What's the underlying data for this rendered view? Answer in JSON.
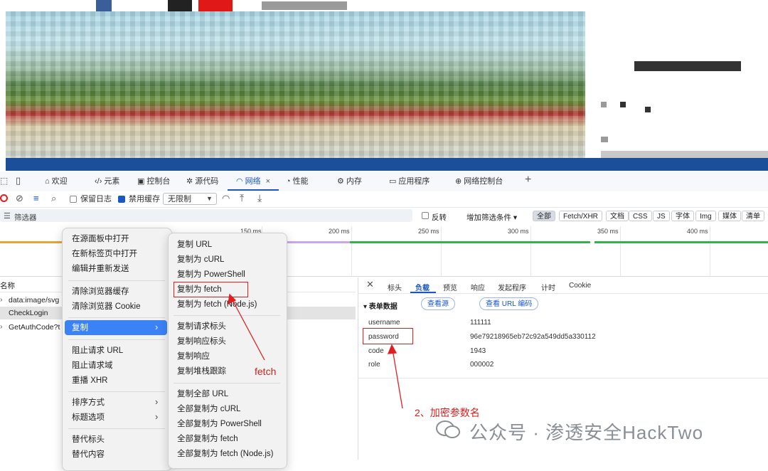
{
  "devtools": {
    "tabs": [
      {
        "label": "欢迎",
        "icon": "home-icon"
      },
      {
        "label": "元素",
        "icon": "code-icon"
      },
      {
        "label": "控制台",
        "icon": "console-icon"
      },
      {
        "label": "源代码",
        "icon": "bug-icon"
      },
      {
        "label": "网络",
        "icon": "wifi-icon",
        "active": true
      },
      {
        "label": "性能",
        "icon": "gauge-icon"
      },
      {
        "label": "内存",
        "icon": "chip-icon"
      },
      {
        "label": "应用程序",
        "icon": "window-icon"
      },
      {
        "label": "网络控制台",
        "icon": "globe-icon"
      }
    ],
    "add_tab_glyph": "+",
    "tab_close_glyph": "×",
    "toolbar": {
      "preserve_log": "保留日志",
      "disable_cache": "禁用缓存",
      "throttle": "无限制"
    },
    "filter": {
      "placeholder": "筛选器",
      "invert": "反转",
      "more_filters": "增加筛选条件 ▾",
      "chips": [
        "全部",
        "Fetch/XHR",
        "文档",
        "CSS",
        "JS",
        "字体",
        "Img",
        "媒体",
        "清单"
      ]
    },
    "timeline_ticks": [
      "150 ms",
      "200 ms",
      "250 ms",
      "300 ms",
      "350 ms",
      "400 ms"
    ],
    "list": {
      "header": "名称",
      "rows": [
        "data:image/svg",
        "CheckLogin",
        "GetAuthCode?t"
      ]
    },
    "detail": {
      "close_glyph": "✕",
      "tabs": [
        "标头",
        "负载",
        "预览",
        "响应",
        "发起程序",
        "计时",
        "Cookie"
      ],
      "active_tab": "负载",
      "section": "▾ 表单数据",
      "view_source": "查看源",
      "view_url": "查看 URL 编码",
      "form": [
        {
          "key": "username",
          "value": "111111"
        },
        {
          "key": "password",
          "value": "96e79218965eb72c92a549dd5a330112"
        },
        {
          "key": "code",
          "value": "1943"
        },
        {
          "key": "role",
          "value": "000002"
        }
      ]
    }
  },
  "context_menu": {
    "items": [
      "在源面板中打开",
      "在新标签页中打开",
      "编辑并重新发送",
      "清除浏览器缓存",
      "清除浏览器 Cookie",
      "复制",
      "阻止请求 URL",
      "阻止请求域",
      "重播 XHR",
      "排序方式",
      "标题选项",
      "替代标头",
      "替代内容"
    ],
    "submenu_glyph": "›"
  },
  "copy_submenu": {
    "items": [
      "复制 URL",
      "复制为 cURL",
      "复制为 PowerShell",
      "复制为 fetch",
      "复制为 fetch (Node.js)",
      "复制请求标头",
      "复制响应标头",
      "复制响应",
      "复制堆栈跟踪",
      "复制全部 URL",
      "全部复制为 cURL",
      "全部复制为 PowerShell",
      "全部复制为 fetch",
      "全部复制为 fetch (Node.js)"
    ]
  },
  "annotations": {
    "fetch": "fetch",
    "param": "2、加密参数名"
  },
  "watermark": "公众号 · 渗透安全HackTwo",
  "colors": {
    "accent": "#1a56c5",
    "annotation": "#e02020",
    "menu_highlight": "#3b82f6"
  }
}
